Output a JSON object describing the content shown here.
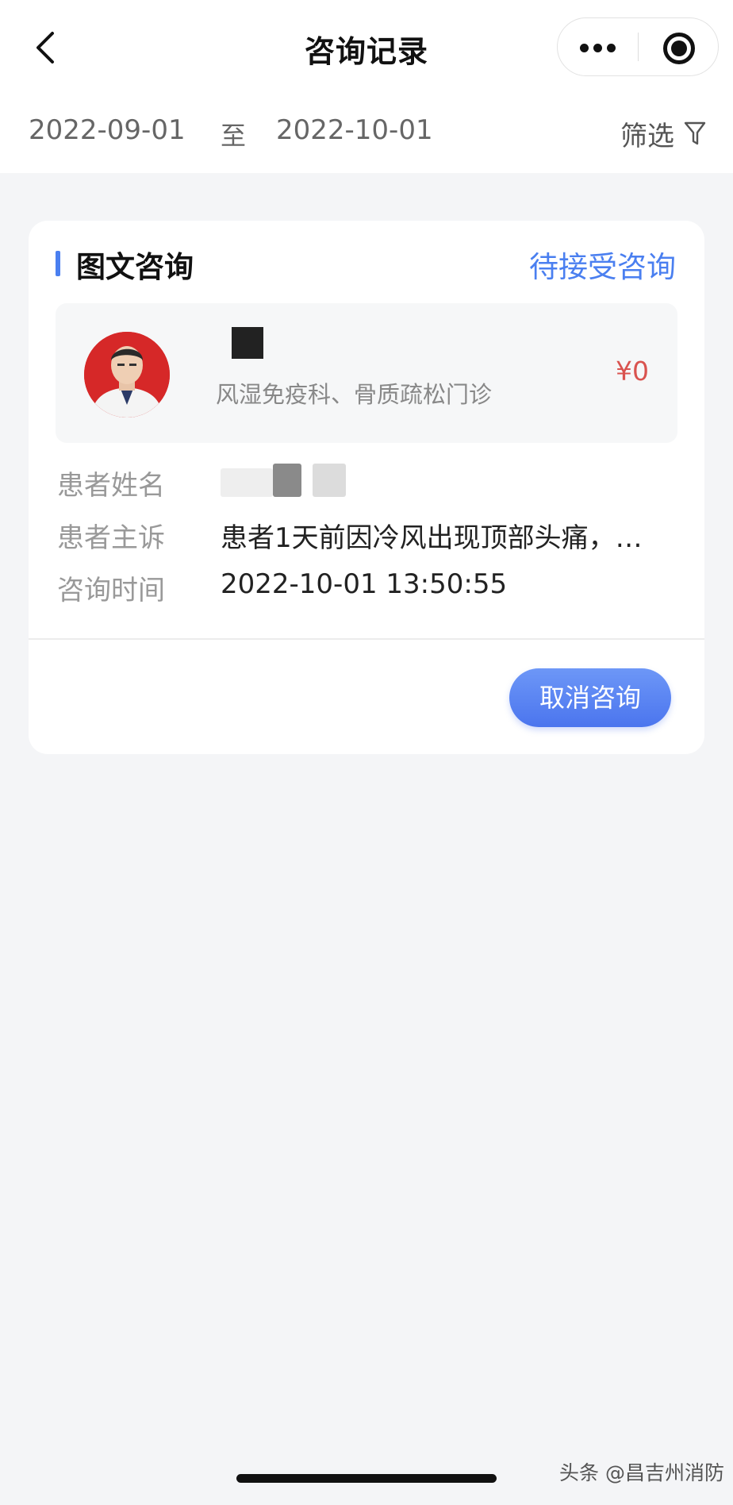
{
  "nav": {
    "title": "咨询记录",
    "back_icon": "chevron-left-icon",
    "more_icon": "more-dots-icon",
    "close_icon": "target-close-icon"
  },
  "filter": {
    "start_date": "2022-09-01",
    "separator": "至",
    "end_date": "2022-10-01",
    "filter_label": "筛选",
    "filter_icon": "funnel-icon"
  },
  "card": {
    "title": "图文咨询",
    "status": "待接受咨询",
    "doctor": {
      "department": "风湿免疫科、骨质疏松门诊",
      "price": "¥0"
    },
    "rows": [
      {
        "label": "患者姓名",
        "value": ""
      },
      {
        "label": "患者主诉",
        "value": "患者1天前因冷风出现顶部头痛，…"
      },
      {
        "label": "咨询时间",
        "value": "2022-10-01 13:50:55"
      }
    ],
    "cancel_label": "取消咨询"
  },
  "watermark": "头条 @昌吉州消防",
  "colors": {
    "accent": "#4a7ff0",
    "price": "#d9534f",
    "background": "#f4f5f7"
  }
}
